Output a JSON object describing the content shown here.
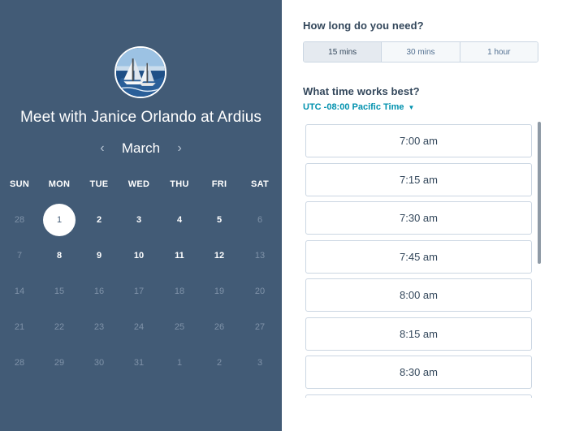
{
  "profile": {
    "title": "Meet with Janice Orlando at Ardius"
  },
  "calendar": {
    "month": "March",
    "prev_icon": "chevron-left-icon",
    "next_icon": "chevron-right-icon",
    "weekdays": [
      "SUN",
      "MON",
      "TUE",
      "WED",
      "THU",
      "FRI",
      "SAT"
    ],
    "weeks": [
      [
        "28",
        "1",
        "2",
        "3",
        "4",
        "5",
        "6"
      ],
      [
        "7",
        "8",
        "9",
        "10",
        "11",
        "12",
        "13"
      ],
      [
        "14",
        "15",
        "16",
        "17",
        "18",
        "19",
        "20"
      ],
      [
        "21",
        "22",
        "23",
        "24",
        "25",
        "26",
        "27"
      ],
      [
        "28",
        "29",
        "30",
        "31",
        "1",
        "2",
        "3"
      ]
    ],
    "available": [
      "1",
      "2",
      "3",
      "4",
      "5",
      "8",
      "9",
      "10",
      "11",
      "12"
    ],
    "selected": "1"
  },
  "duration": {
    "heading": "How long do you need?",
    "options": [
      "15 mins",
      "30 mins",
      "1 hour"
    ],
    "selected": "15 mins"
  },
  "time": {
    "heading": "What time works best?",
    "timezone": "UTC -08:00 Pacific Time",
    "slots": [
      "7:00 am",
      "7:15 am",
      "7:30 am",
      "7:45 am",
      "8:00 am",
      "8:15 am",
      "8:30 am",
      ""
    ]
  },
  "colors": {
    "panel": "#425b76",
    "accent": "#0091ae",
    "text": "#33475b"
  }
}
